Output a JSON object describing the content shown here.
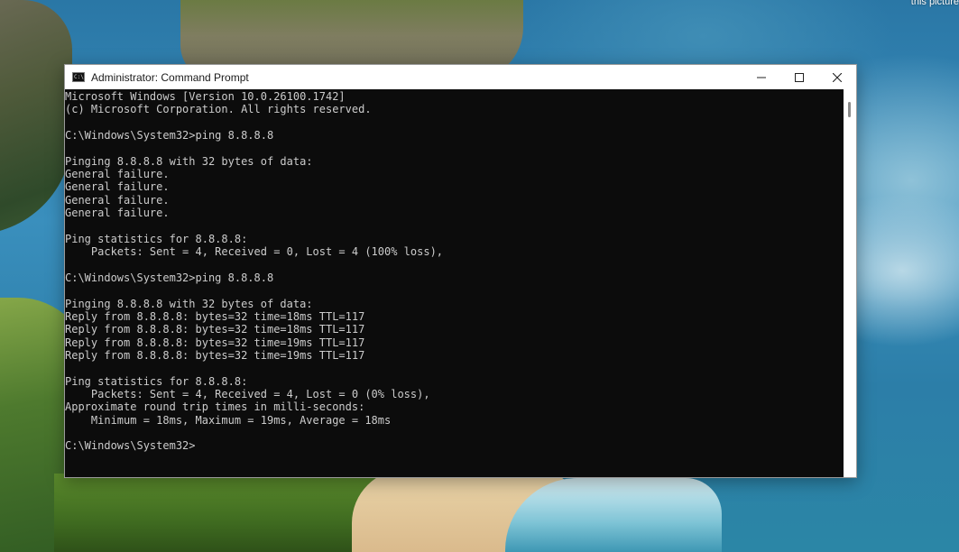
{
  "desktop": {
    "corner_text": "this picture"
  },
  "window": {
    "title": "Administrator: Command Prompt",
    "icon_text": "C:\\",
    "controls": {
      "minimize": "minimize",
      "maximize": "maximize",
      "close": "close"
    }
  },
  "console": {
    "lines": [
      "Microsoft Windows [Version 10.0.26100.1742]",
      "(c) Microsoft Corporation. All rights reserved.",
      "",
      "C:\\Windows\\System32>ping 8.8.8.8",
      "",
      "Pinging 8.8.8.8 with 32 bytes of data:",
      "General failure.",
      "General failure.",
      "General failure.",
      "General failure.",
      "",
      "Ping statistics for 8.8.8.8:",
      "    Packets: Sent = 4, Received = 0, Lost = 4 (100% loss),",
      "",
      "C:\\Windows\\System32>ping 8.8.8.8",
      "",
      "Pinging 8.8.8.8 with 32 bytes of data:",
      "Reply from 8.8.8.8: bytes=32 time=18ms TTL=117",
      "Reply from 8.8.8.8: bytes=32 time=18ms TTL=117",
      "Reply from 8.8.8.8: bytes=32 time=19ms TTL=117",
      "Reply from 8.8.8.8: bytes=32 time=19ms TTL=117",
      "",
      "Ping statistics for 8.8.8.8:",
      "    Packets: Sent = 4, Received = 4, Lost = 0 (0% loss),",
      "Approximate round trip times in milli-seconds:",
      "    Minimum = 18ms, Maximum = 19ms, Average = 18ms",
      "",
      "C:\\Windows\\System32>"
    ]
  },
  "colors": {
    "console_bg": "#0c0c0c",
    "console_text": "#cccccc",
    "titlebar_bg": "#ffffff"
  }
}
